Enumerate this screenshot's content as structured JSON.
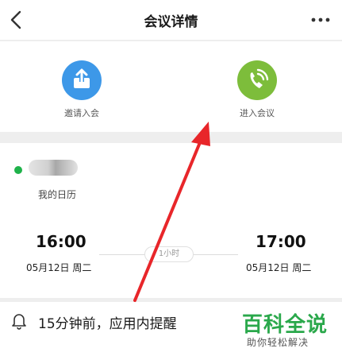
{
  "header": {
    "title": "会议详情",
    "back_icon": "chevron-left-icon",
    "more_icon": "more-horizontal-icon"
  },
  "actions": {
    "invite": {
      "label": "邀请入会",
      "icon": "share-upload-icon",
      "color": "#3d98e8"
    },
    "join": {
      "label": "进入会议",
      "icon": "phone-call-icon",
      "color": "#7dbd3b"
    }
  },
  "calendar": {
    "status_color": "#1fb24a",
    "name": "我的日历",
    "start_time": "16:00",
    "start_date": "05月12日 周二",
    "duration": "1小时",
    "end_time": "17:00",
    "end_date": "05月12日 周二"
  },
  "reminder": {
    "text": "15分钟前，应用内提醒",
    "icon": "bell-icon"
  },
  "watermark": {
    "title": "百科全说",
    "subtitle": "助你轻松解决",
    "color": "#2aa84b"
  },
  "annotation": {
    "arrow_color": "#e8262a"
  }
}
